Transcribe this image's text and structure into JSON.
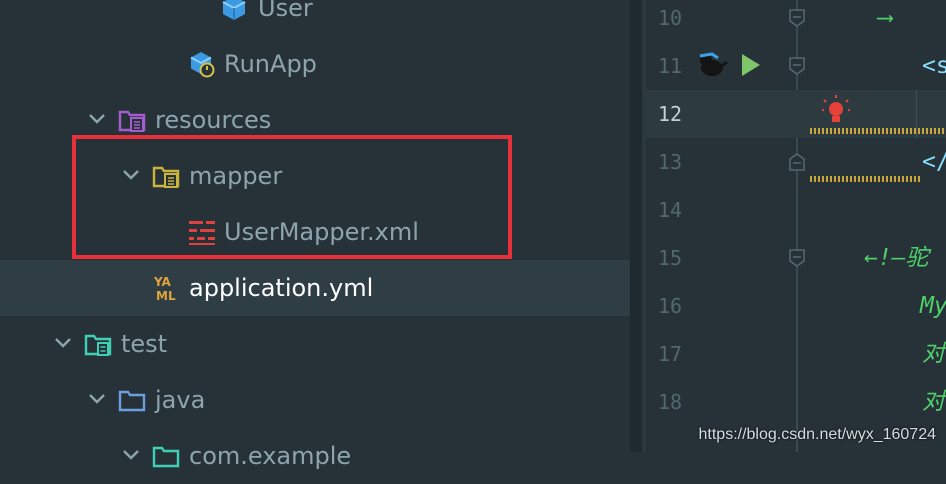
{
  "project_tree": {
    "items": [
      {
        "label": "User",
        "icon": "java-class-icon",
        "expanded": null,
        "selected": false
      },
      {
        "label": "RunApp",
        "icon": "spring-boot-class-icon",
        "expanded": null,
        "selected": false
      },
      {
        "label": "resources",
        "icon": "resources-folder-icon",
        "expanded": true,
        "selected": false
      },
      {
        "label": "mapper",
        "icon": "package-folder-icon",
        "expanded": true,
        "selected": false
      },
      {
        "label": "UserMapper.xml",
        "icon": "mybatis-xml-icon",
        "expanded": null,
        "selected": false
      },
      {
        "label": "application.yml",
        "icon": "yaml-file-icon",
        "expanded": null,
        "selected": true
      },
      {
        "label": "test",
        "icon": "test-folder-icon",
        "expanded": true,
        "selected": false
      },
      {
        "label": "java",
        "icon": "source-folder-icon",
        "expanded": true,
        "selected": false
      },
      {
        "label": "com.example",
        "icon": "package-folder-icon",
        "expanded": true,
        "selected": false
      }
    ]
  },
  "annotation": {
    "color": "#e8303a"
  },
  "editor": {
    "lines": [
      {
        "number": "10",
        "code": "⟶",
        "color": "#4fcf6a"
      },
      {
        "number": "11",
        "code": "<s",
        "color": "#89ddff"
      },
      {
        "number": "12",
        "code": "",
        "color": "#89ddff"
      },
      {
        "number": "13",
        "code": "</",
        "color": "#89ddff"
      },
      {
        "number": "14",
        "code": "",
        "color": "#89ddff"
      },
      {
        "number": "15",
        "code": "←!—驼",
        "color": "#4fcf6a"
      },
      {
        "number": "16",
        "code": "My",
        "color": "#4fcf6a"
      },
      {
        "number": "17",
        "code": "对",
        "color": "#4fcf6a"
      },
      {
        "number": "18",
        "code": "对",
        "color": "#4fcf6a"
      }
    ]
  },
  "watermark": "https://blog.csdn.net/wyx_160724"
}
